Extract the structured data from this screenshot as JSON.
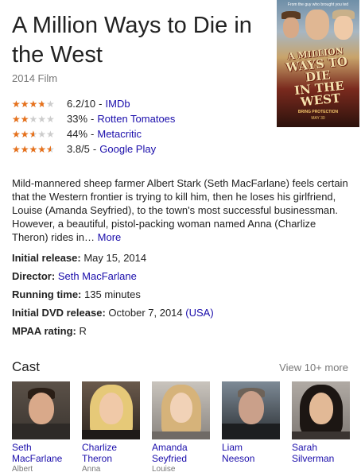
{
  "movie": {
    "title": "A Million Ways to Die in the West",
    "subtitle": "2014 Film"
  },
  "poster": {
    "tagline": "From the guy who brought you ted",
    "title_line1": "A MILLION",
    "title_line2": "WAYS TO DIE",
    "title_line3": "IN THE WEST",
    "release": "BRING PROTECTION",
    "date": "MAY 30"
  },
  "ratings": [
    {
      "score": "6.2/10",
      "source": "IMDb",
      "stars_fraction": 0.62
    },
    {
      "score": "33%",
      "source": "Rotten Tomatoes",
      "stars_fraction": 0.33
    },
    {
      "score": "44%",
      "source": "Metacritic",
      "stars_fraction": 0.44
    },
    {
      "score": "3.8/5",
      "source": "Google Play",
      "stars_fraction": 0.76
    }
  ],
  "description": {
    "text": "Mild-mannered sheep farmer Albert Stark (Seth MacFarlane) feels certain that the Western frontier is trying to kill him, then he loses his girlfriend, Louise (Amanda Seyfried), to the town's most successful businessman. However, a beautiful, pistol-packing woman named Anna (Charlize Theron) rides in…",
    "more": "More"
  },
  "facts": {
    "release_label": "Initial release:",
    "release_value": "May 15, 2014",
    "director_label": "Director:",
    "director_value": "Seth MacFarlane",
    "runtime_label": "Running time:",
    "runtime_value": "135 minutes",
    "dvd_label": "Initial DVD release:",
    "dvd_value": "October 7, 2014",
    "dvd_region": "(USA)",
    "mpaa_label": "MPAA rating:",
    "mpaa_value": "R"
  },
  "cast": {
    "title": "Cast",
    "more": "View 10+ more",
    "members": [
      {
        "first": "Seth",
        "last": "MacFarlane",
        "role": "Albert"
      },
      {
        "first": "Charlize",
        "last": "Theron",
        "role": "Anna"
      },
      {
        "first": "Amanda",
        "last": "Seyfried",
        "role": "Louise"
      },
      {
        "first": "Liam",
        "last": "Neeson",
        "role": ""
      },
      {
        "first": "Sarah",
        "last": "Silverman",
        "role": ""
      }
    ]
  },
  "colors": {
    "link": "#1a0dab",
    "star": "#e7711b",
    "muted": "#777777"
  }
}
